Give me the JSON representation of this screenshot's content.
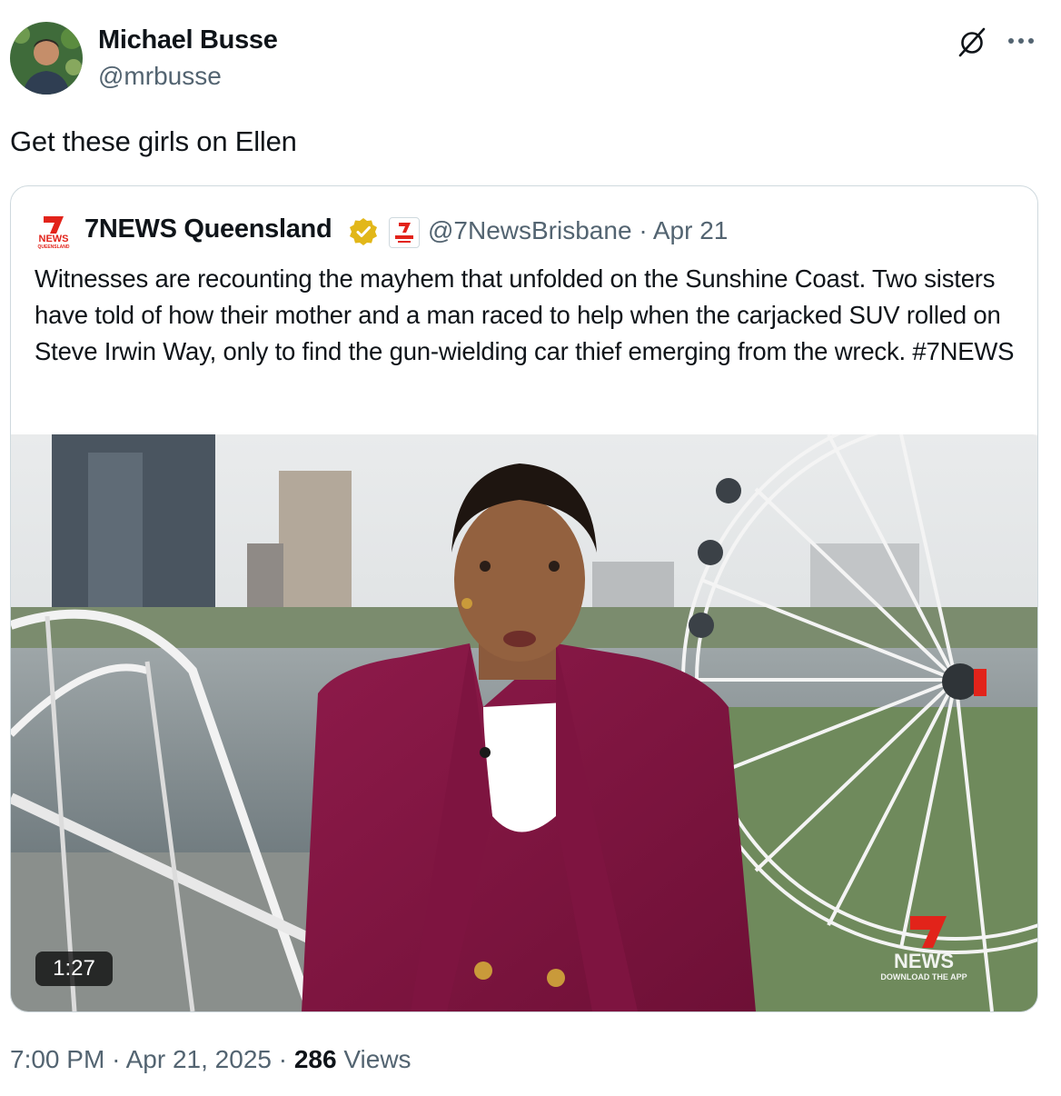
{
  "author": {
    "name": "Michael Busse",
    "handle": "@mrbusse"
  },
  "tweet": {
    "text": "Get these girls on Ellen"
  },
  "icons": {
    "grok": "grok-slash-icon",
    "more": "more-horizontal-icon",
    "verified": "gold-verified-badge-icon"
  },
  "colors": {
    "accent_gold": "#e2b719",
    "brand_red": "#e2231a",
    "muted": "#536471",
    "border": "#cfd9de"
  },
  "quote": {
    "logo_text": "NEWS",
    "logo_subtext": "QUEENSLAND",
    "name": "7NEWS Queensland",
    "handle": "@7NewsBrisbane",
    "sep": "·",
    "date": "Apr 21",
    "text": "Witnesses are recounting the mayhem that unfolded on the Sunshine Coast. Two sisters have told of how their mother and a man raced to help when the carjacked SUV rolled on Steve Irwin Way, only to find the gun-wielding car thief emerging from the wreck.  #7NEWS",
    "video": {
      "duration": "1:27",
      "watermark_text": "NEWS",
      "watermark_subtext": "DOWNLOAD THE APP"
    }
  },
  "footer": {
    "time": "7:00 PM",
    "sep": "·",
    "date": "Apr 21, 2025",
    "views_count": "286",
    "views_label": "Views"
  }
}
